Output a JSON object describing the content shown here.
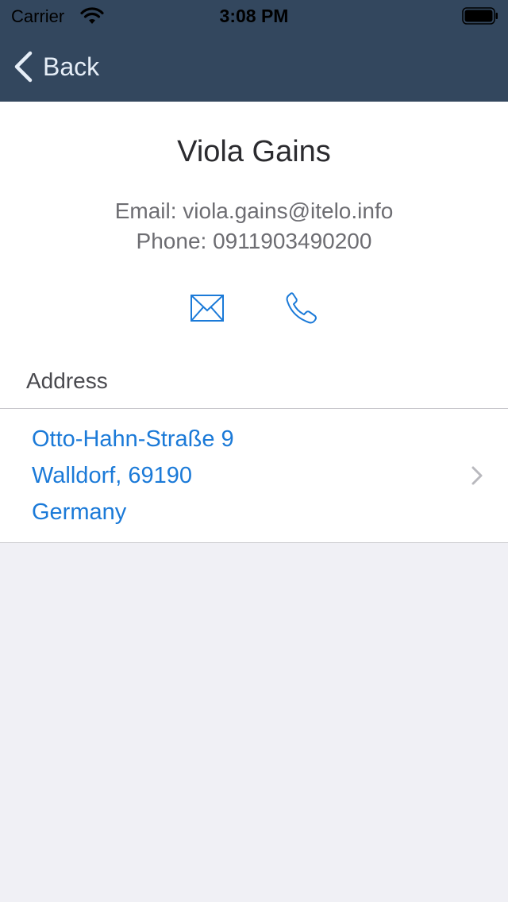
{
  "status_bar": {
    "carrier": "Carrier",
    "time": "3:08 PM",
    "wifi_icon": "wifi-icon",
    "battery_icon": "battery-icon"
  },
  "nav": {
    "back_label": "Back",
    "back_icon": "chevron-left-icon"
  },
  "contact": {
    "name": "Viola Gains",
    "email_line": "Email: viola.gains@itelo.info",
    "phone_line": "Phone: 0911903490200"
  },
  "actions": {
    "mail_icon": "envelope-icon",
    "call_icon": "phone-icon"
  },
  "address_section": {
    "title": "Address",
    "street": "Otto-Hahn-Straße 9",
    "city_zip": "Walldorf, 69190",
    "country": "Germany",
    "disclosure_icon": "chevron-right-icon"
  },
  "colors": {
    "nav_bar": "#33475e",
    "accent": "#1b7ad8",
    "background": "#f0f0f5"
  }
}
